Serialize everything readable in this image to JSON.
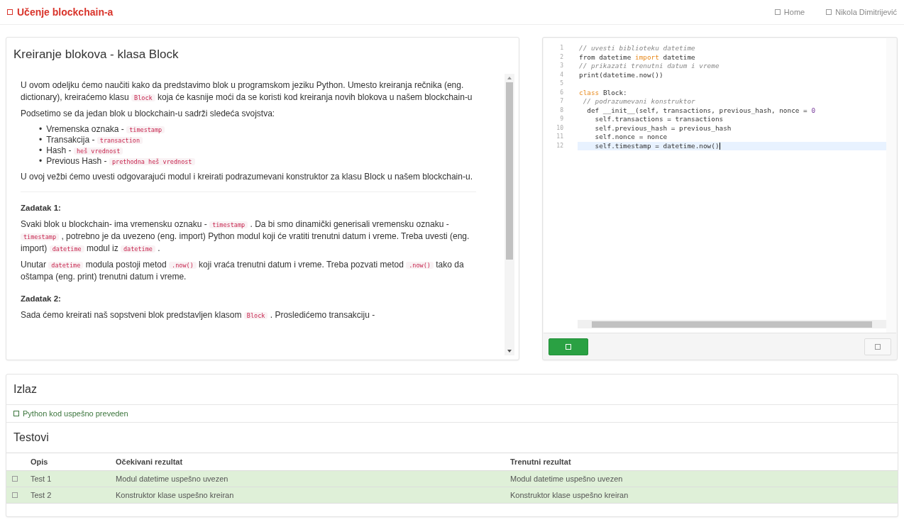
{
  "navbar": {
    "brand": "Učenje blockchain-a",
    "links": [
      {
        "label": "Home"
      },
      {
        "label": "Nikola Dimitrijević"
      }
    ]
  },
  "lesson": {
    "title": "Kreiranje blokova - klasa Block",
    "intro": [
      [
        {
          "kind": "text",
          "text": "U ovom odeljku ćemo naučiti kako da predstavimo blok u programskom jeziku Python. Umesto kreiranja rečnika (eng. dictionary), kreiraćemo klasu "
        },
        {
          "kind": "code",
          "text": "Block"
        },
        {
          "kind": "text",
          "text": " koja će kasnije moći da se koristi kod kreiranja novih blokova u našem blockchain-u"
        }
      ],
      [
        {
          "kind": "text",
          "text": "Podsetimo se da jedan blok u blockchain-u sadrži sledeća svojstva:"
        }
      ]
    ],
    "properties": [
      {
        "marker": "•",
        "segments": [
          {
            "kind": "text",
            "text": "Vremenska oznaka - "
          },
          {
            "kind": "code",
            "text": "timestamp"
          }
        ]
      },
      {
        "marker": "•",
        "segments": [
          {
            "kind": "text",
            "text": "Transakcija - "
          },
          {
            "kind": "code",
            "text": "transaction"
          }
        ]
      },
      {
        "marker": "•",
        "segments": [
          {
            "kind": "text",
            "text": "Hash - "
          },
          {
            "kind": "code",
            "text": "heš vrednost"
          }
        ]
      },
      {
        "marker": "•",
        "segments": [
          {
            "kind": "text",
            "text": "Previous Hash - "
          },
          {
            "kind": "code",
            "text": "prethodna heš vrednost"
          }
        ]
      }
    ],
    "outro": [
      [
        {
          "kind": "text",
          "text": "U ovoj vežbi ćemo uvesti odgovarajući modul i kreirati podrazumevani konstruktor za klasu Block u našem blockchain-u."
        }
      ]
    ],
    "tasks": [
      {
        "title": "Zadatak 1:",
        "paragraphs": [
          [
            {
              "kind": "text",
              "text": "Svaki blok u blockchain- ima vremensku oznaku - "
            },
            {
              "kind": "code",
              "text": "timestamp"
            },
            {
              "kind": "text",
              "text": " . Da bi smo dinamički generisali vremensku oznaku - "
            },
            {
              "kind": "code",
              "text": "timestamp"
            },
            {
              "kind": "text",
              "text": " , potrebno je da uvezeno (eng. import) Python modul koji će vratiti trenutni datum i vreme. Treba uvesti (eng. import) "
            },
            {
              "kind": "code",
              "text": "datetime"
            },
            {
              "kind": "text",
              "text": " modul iz "
            },
            {
              "kind": "code",
              "text": "datetime"
            },
            {
              "kind": "text",
              "text": " ."
            }
          ],
          [
            {
              "kind": "text",
              "text": "Unutar "
            },
            {
              "kind": "code",
              "text": "datetime"
            },
            {
              "kind": "text",
              "text": " modula postoji metod "
            },
            {
              "kind": "code",
              "text": ".now()"
            },
            {
              "kind": "text",
              "text": " koji vraća trenutni datum i vreme. Treba pozvati metod "
            },
            {
              "kind": "code",
              "text": ".now()"
            },
            {
              "kind": "text",
              "text": " tako da oštampa (eng. print) trenutni datum i vreme."
            }
          ]
        ]
      },
      {
        "title": "Zadatak 2:",
        "paragraphs": [
          [
            {
              "kind": "text",
              "text": "Sada ćemo kreirati naš sopstveni blok predstavljen klasom "
            },
            {
              "kind": "code",
              "text": "Block"
            },
            {
              "kind": "text",
              "text": " . Prosledićemo transakciju -"
            }
          ]
        ]
      }
    ]
  },
  "editor": {
    "lines": [
      {
        "number": "1",
        "active": false,
        "tokens": [
          {
            "kind": "comment",
            "text": "// uvesti biblioteku datetime"
          }
        ]
      },
      {
        "number": "2",
        "active": false,
        "tokens": [
          {
            "kind": "plain",
            "text": "from datetime "
          },
          {
            "kind": "keyword",
            "text": "import"
          },
          {
            "kind": "plain",
            "text": " datetime"
          }
        ]
      },
      {
        "number": "3",
        "active": false,
        "tokens": [
          {
            "kind": "comment",
            "text": "// prikazati trenutni datum i vreme"
          }
        ]
      },
      {
        "number": "4",
        "active": false,
        "tokens": [
          {
            "kind": "plain",
            "text": "print(datetime.now())"
          }
        ]
      },
      {
        "number": "5",
        "active": false
      },
      {
        "number": "6",
        "active": false,
        "tokens": [
          {
            "kind": "keyword",
            "text": "class"
          },
          {
            "kind": "plain",
            "text": " Block:"
          }
        ]
      },
      {
        "number": "7",
        "active": false,
        "tokens": [
          {
            "kind": "comment",
            "text": " // podrazumevani konstruktor"
          }
        ]
      },
      {
        "number": "8",
        "active": false,
        "tokens": [
          {
            "kind": "plain",
            "text": "  def __init__(self, transactions, previous_hash, nonce = "
          },
          {
            "kind": "number",
            "text": "0"
          }
        ]
      },
      {
        "number": "9",
        "active": false,
        "tokens": [
          {
            "kind": "plain",
            "text": "    self.transactions = transactions"
          }
        ]
      },
      {
        "number": "10",
        "active": false,
        "tokens": [
          {
            "kind": "plain",
            "text": "    self.previous_hash = previous_hash"
          }
        ]
      },
      {
        "number": "11",
        "active": false,
        "tokens": [
          {
            "kind": "plain",
            "text": "    self.nonce = nonce"
          }
        ]
      },
      {
        "number": "12",
        "active": true,
        "tokens": [
          {
            "kind": "plain",
            "text": "    self.timestamp = datetime.now()"
          }
        ]
      }
    ]
  },
  "output": {
    "title": "Izlaz",
    "message": "Python kod uspešno preveden"
  },
  "tests": {
    "title": "Testovi",
    "columns": [
      "Opis",
      "Očekivani rezultat",
      "Trenutni rezultat"
    ],
    "rows": [
      {
        "passed": true,
        "name": "Test 1",
        "expected": "Modul datetime uspešno uvezen",
        "actual": "Modul datetime uspešno uvezen"
      },
      {
        "passed": true,
        "name": "Test 2",
        "expected": "Konstruktor klase uspešno kreiran",
        "actual": "Konstruktor klase uspešno kreiran"
      }
    ]
  }
}
